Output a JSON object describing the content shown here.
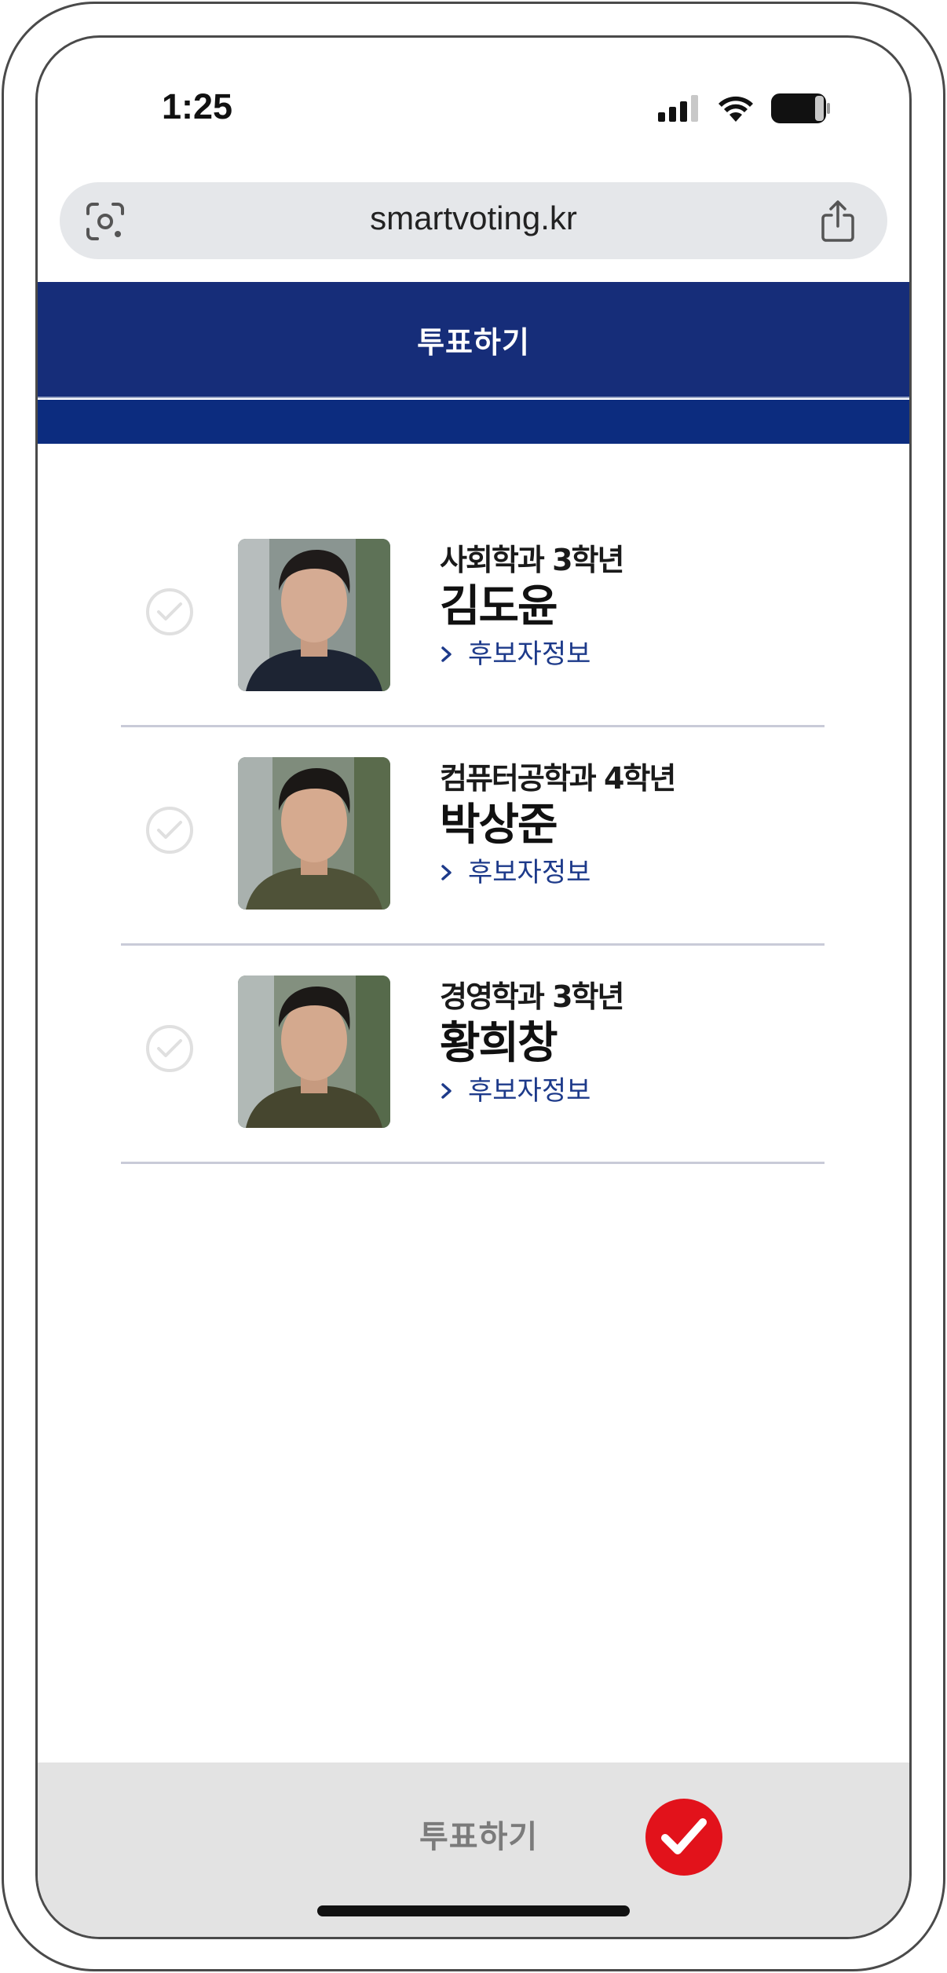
{
  "status_bar": {
    "time": "1:25"
  },
  "browser": {
    "url": "smartvoting.kr"
  },
  "header": {
    "title": "투표하기"
  },
  "candidates": [
    {
      "dept": "사회학과 3학년",
      "name": "김도윤",
      "info_label": "후보자정보"
    },
    {
      "dept": "컴퓨터공학과 4학년",
      "name": "박상준",
      "info_label": "후보자정보"
    },
    {
      "dept": "경영학과 3학년",
      "name": "황희창",
      "info_label": "후보자정보"
    }
  ],
  "footer": {
    "vote_label": "투표하기"
  },
  "colors": {
    "header_bg": "#162d79",
    "sub_bar": "#0c2c7f",
    "link": "#1d3a8a",
    "vote_check": "#e2121b",
    "footer_bg": "#e3e3e3"
  },
  "icons": [
    "signal-icon",
    "wifi-icon",
    "battery-icon",
    "lens-icon",
    "share-icon",
    "check-icon",
    "chevron-right-icon"
  ]
}
